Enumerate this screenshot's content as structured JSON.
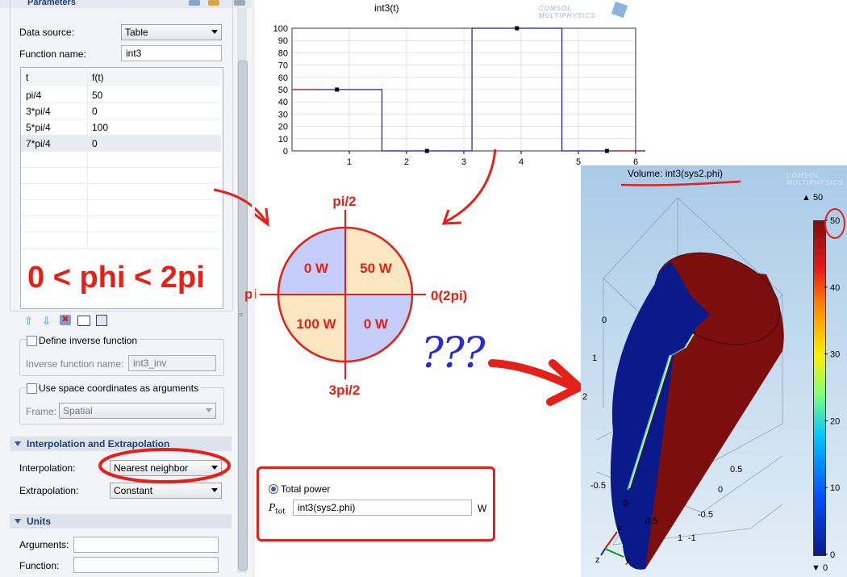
{
  "panel": {
    "section_parameters": "Parameters",
    "data_source_label": "Data source:",
    "data_source_value": "Table",
    "function_name_label": "Function name:",
    "function_name_value": "int3",
    "table_headers": [
      "t",
      "f(t)"
    ],
    "table_rows": [
      {
        "t": "pi/4",
        "f": "50"
      },
      {
        "t": "3*pi/4",
        "f": "0"
      },
      {
        "t": "5*pi/4",
        "f": "100"
      },
      {
        "t": "7*pi/4",
        "f": "0"
      }
    ],
    "define_inverse_label": "Define inverse function",
    "inverse_name_label": "Inverse function name:",
    "inverse_name_value": "int3_inv",
    "space_coords_label": "Use space coordinates as arguments",
    "frame_label": "Frame:",
    "frame_value": "Spatial",
    "section_interp": "Interpolation and Extrapolation",
    "interpolation_label": "Interpolation:",
    "interpolation_value": "Nearest neighbor",
    "extrapolation_label": "Extrapolation:",
    "extrapolation_value": "Constant",
    "section_units": "Units",
    "arguments_label": "Arguments:",
    "function_label": "Function:"
  },
  "annotation_range": "0 < phi < 2pi",
  "plot": {
    "title": "int3(t)",
    "watermark": "COMSOL MULTIPHYSICS",
    "y_ticks": [
      "0",
      "10",
      "20",
      "30",
      "40",
      "50",
      "60",
      "70",
      "80",
      "90",
      "100"
    ],
    "x_ticks": [
      "1",
      "2",
      "3",
      "4",
      "5",
      "6"
    ]
  },
  "chart_data": {
    "type": "line",
    "title": "int3(t)",
    "x": [
      0,
      1.5708,
      1.5708,
      3.1416,
      3.1416,
      4.7124,
      4.7124,
      6.2832
    ],
    "y": [
      50,
      50,
      0,
      0,
      100,
      100,
      0,
      0
    ],
    "markers": [
      {
        "x": 0.785,
        "y": 50
      },
      {
        "x": 2.356,
        "y": 0
      },
      {
        "x": 3.927,
        "y": 100
      },
      {
        "x": 5.498,
        "y": 0
      }
    ],
    "xlim": [
      0,
      6
    ],
    "ylim": [
      0,
      100
    ],
    "grid": true,
    "color": "#1a1a9c"
  },
  "circle": {
    "top": "pi/2",
    "bottom": "3pi/2",
    "left": "pi",
    "right": "0(2pi)",
    "q_top_left": "0 W",
    "q_top_right": "50 W",
    "q_bottom_left": "100 W",
    "q_bottom_right": "0 W",
    "colors": {
      "blue": "#c5cdfb",
      "orange": "#fde7c3",
      "red": "#e32119"
    }
  },
  "question": "???",
  "power": {
    "option_label": "Total power",
    "symbol": "P",
    "symbol_sub": "tot",
    "expression": "int3(sys2.phi)",
    "unit": "W"
  },
  "volume": {
    "title": "Volume: int3(sys2.phi)",
    "watermark": "COMSOL MULTIPHYSICS",
    "max_label": "▲ 50",
    "min_label": "▼ 0",
    "colorbar_ticks": [
      "50",
      "40",
      "30",
      "20",
      "10",
      "0"
    ],
    "axis_labels_left": [
      "0",
      "1",
      "2"
    ],
    "axis_labels_bottom": [
      "-0.5",
      "0",
      "0.5",
      "1",
      "-1",
      "-0.5",
      "0",
      "0.5"
    ],
    "axis_x": "x",
    "axis_y": "y",
    "axis_z": "z",
    "colors": {
      "bg_top": "#a9cbe8",
      "bg_bottom": "#e4eef6",
      "hot": "#7c0e0e",
      "cold": "#0a1a8a"
    }
  }
}
